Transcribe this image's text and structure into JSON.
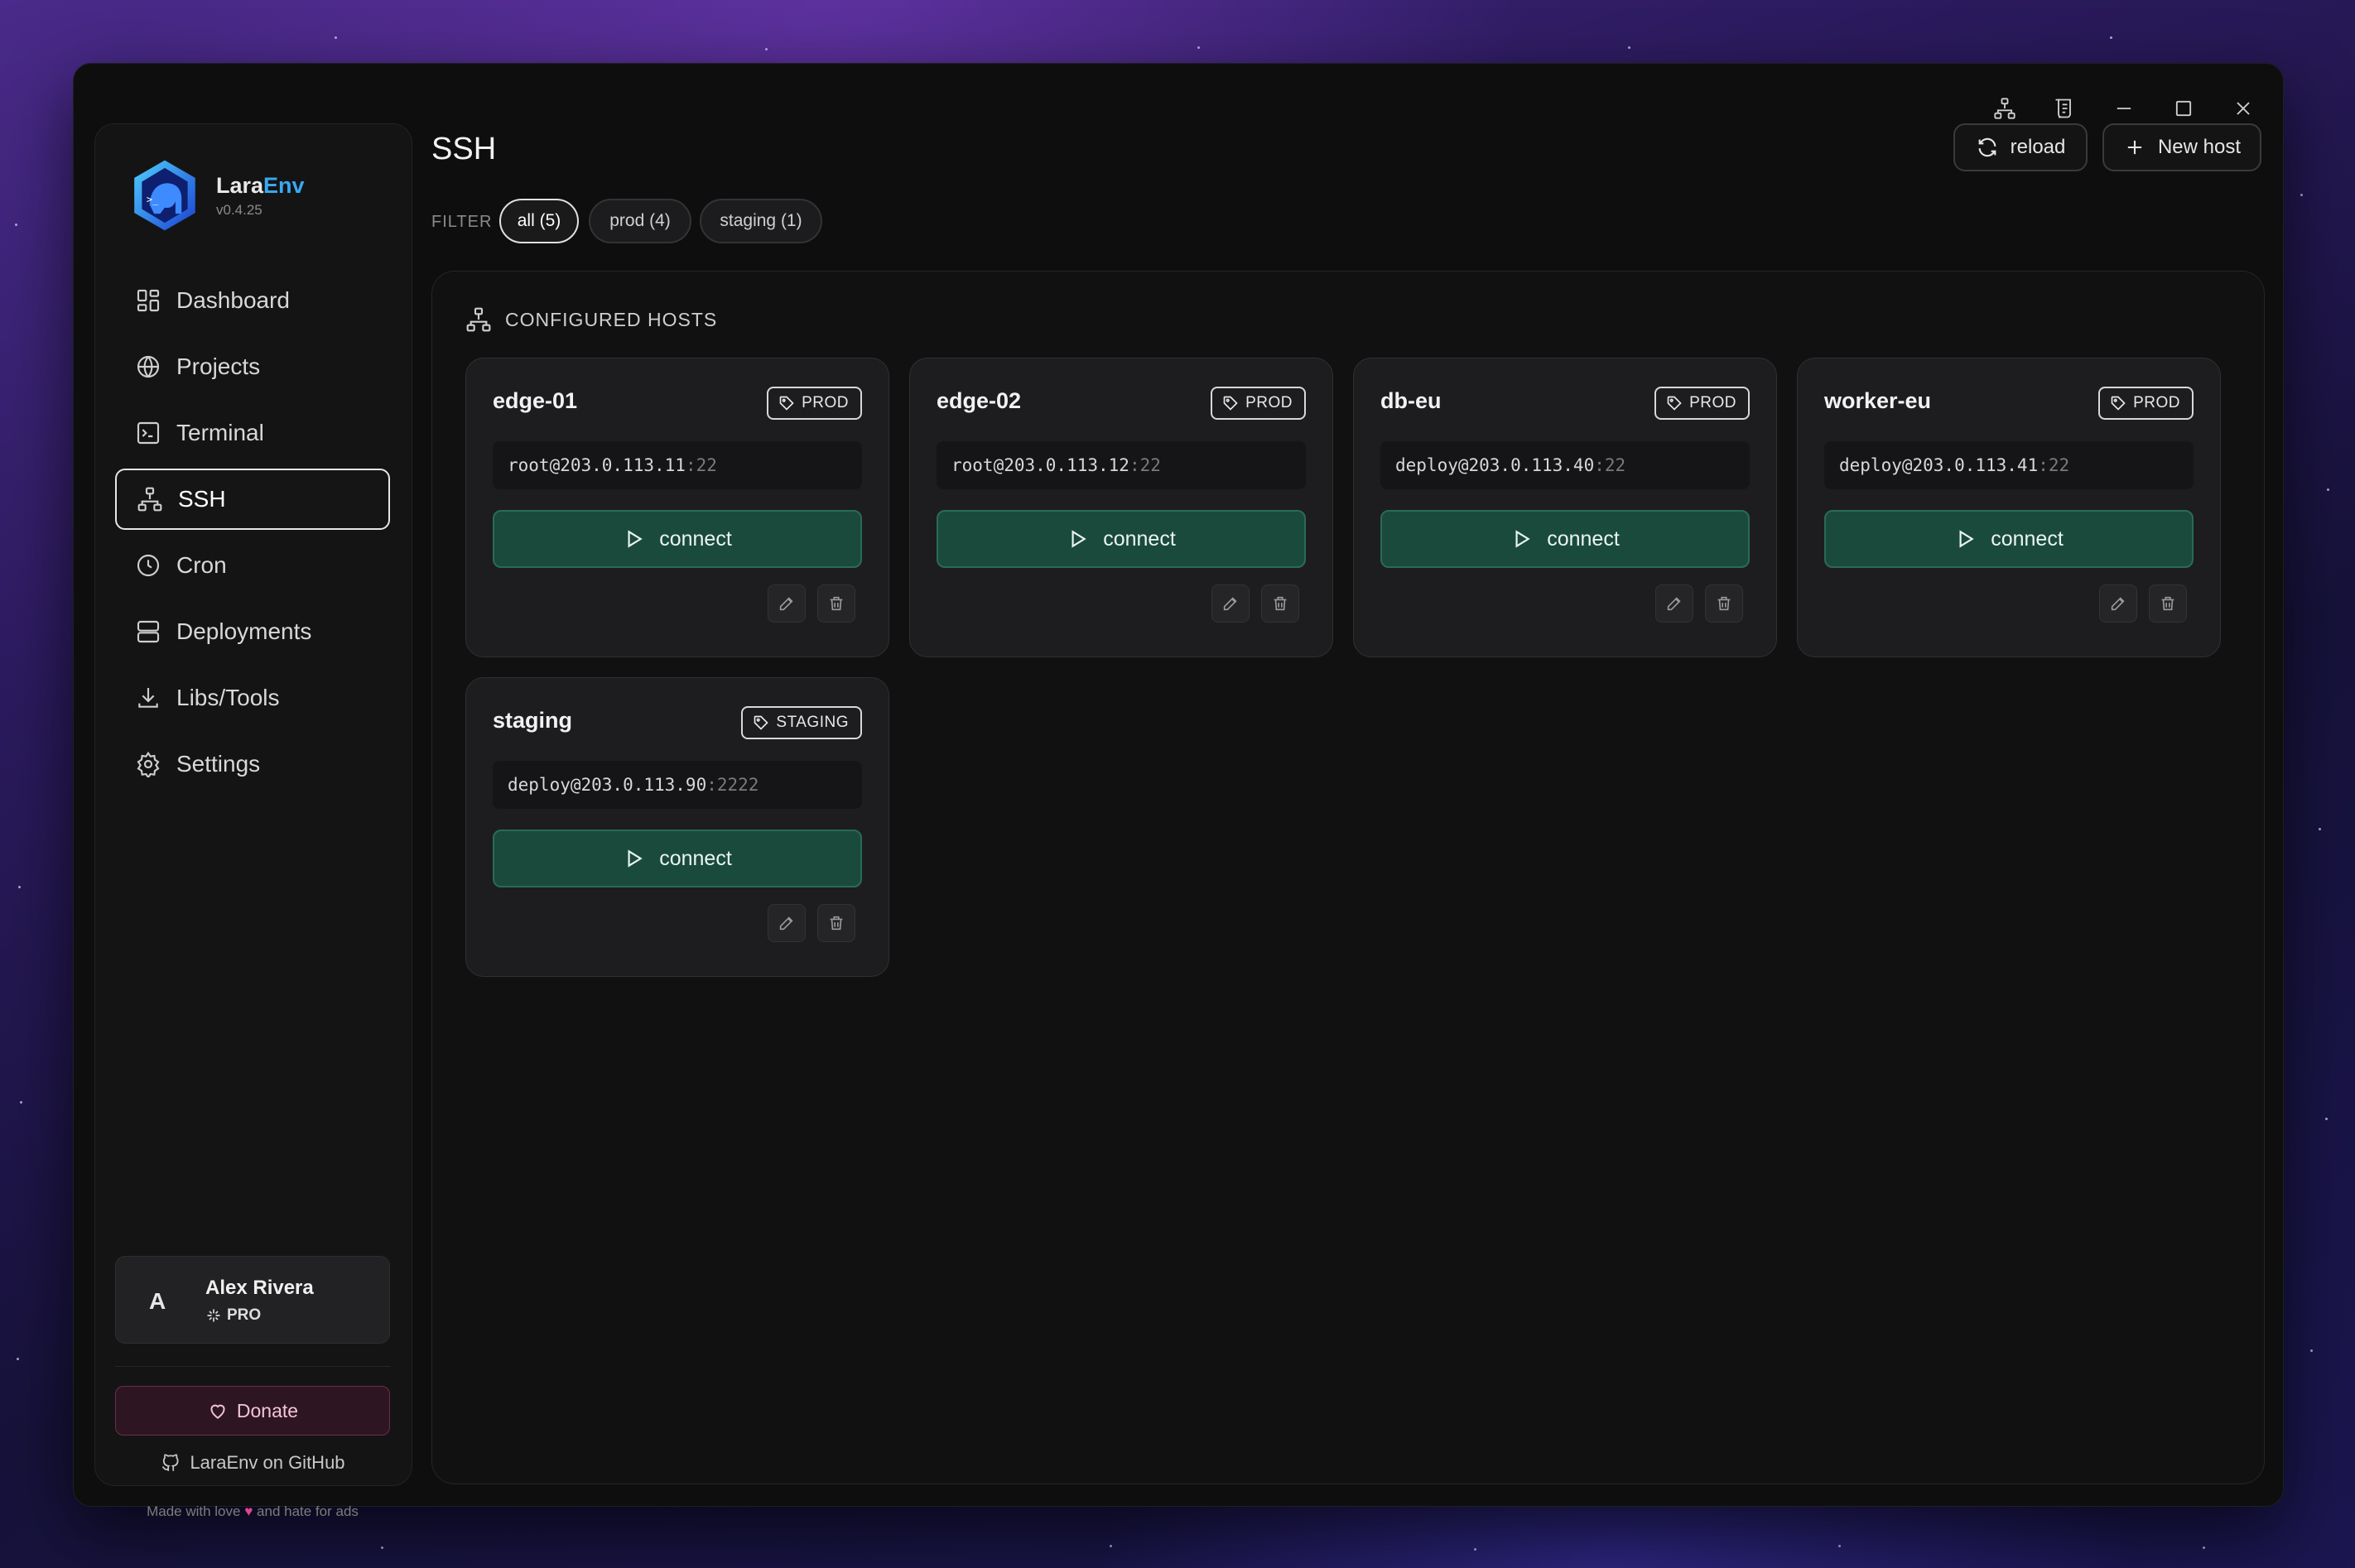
{
  "app": {
    "brand_prefix": "Lara",
    "brand_suffix": "Env",
    "version": "v0.4.25"
  },
  "sidebar": {
    "items": [
      {
        "label": "Dashboard",
        "icon": "dashboard-icon"
      },
      {
        "label": "Projects",
        "icon": "globe-icon"
      },
      {
        "label": "Terminal",
        "icon": "terminal-icon"
      },
      {
        "label": "SSH",
        "icon": "network-icon",
        "active": true
      },
      {
        "label": "Cron",
        "icon": "clock-icon"
      },
      {
        "label": "Deployments",
        "icon": "server-icon"
      },
      {
        "label": "Libs/Tools",
        "icon": "download-icon"
      },
      {
        "label": "Settings",
        "icon": "gear-icon"
      }
    ],
    "user": {
      "avatar": "A",
      "name": "Alex Rivera",
      "plan": "PRO"
    },
    "donate_label": "Donate",
    "github_label": "LaraEnv on GitHub",
    "footer_prefix": "Made with love",
    "footer_heart": "♥",
    "footer_suffix": "and hate for ads"
  },
  "header": {
    "title": "SSH",
    "reload_label": "reload",
    "new_host_label": "New host"
  },
  "filter": {
    "label": "FILTER",
    "chips": [
      {
        "label": "all (5)",
        "active": true
      },
      {
        "label": "prod (4)",
        "active": false
      },
      {
        "label": "staging (1)",
        "active": false
      }
    ]
  },
  "panel": {
    "title": "CONFIGURED HOSTS"
  },
  "hosts": [
    {
      "name": "edge-01",
      "tag": "PROD",
      "address": "root@203.0.113.11",
      "port": ":22",
      "connect_label": "connect"
    },
    {
      "name": "edge-02",
      "tag": "PROD",
      "address": "root@203.0.113.12",
      "port": ":22",
      "connect_label": "connect"
    },
    {
      "name": "db-eu",
      "tag": "PROD",
      "address": "deploy@203.0.113.40",
      "port": ":22",
      "connect_label": "connect"
    },
    {
      "name": "worker-eu",
      "tag": "PROD",
      "address": "deploy@203.0.113.41",
      "port": ":22",
      "connect_label": "connect"
    },
    {
      "name": "staging",
      "tag": "STAGING",
      "address": "deploy@203.0.113.90",
      "port": ":2222",
      "connect_label": "connect"
    }
  ],
  "colors": {
    "accent_blue": "#39a8f0",
    "connect_green": "#1a4a3c",
    "donate_pink": "#e0458a"
  }
}
